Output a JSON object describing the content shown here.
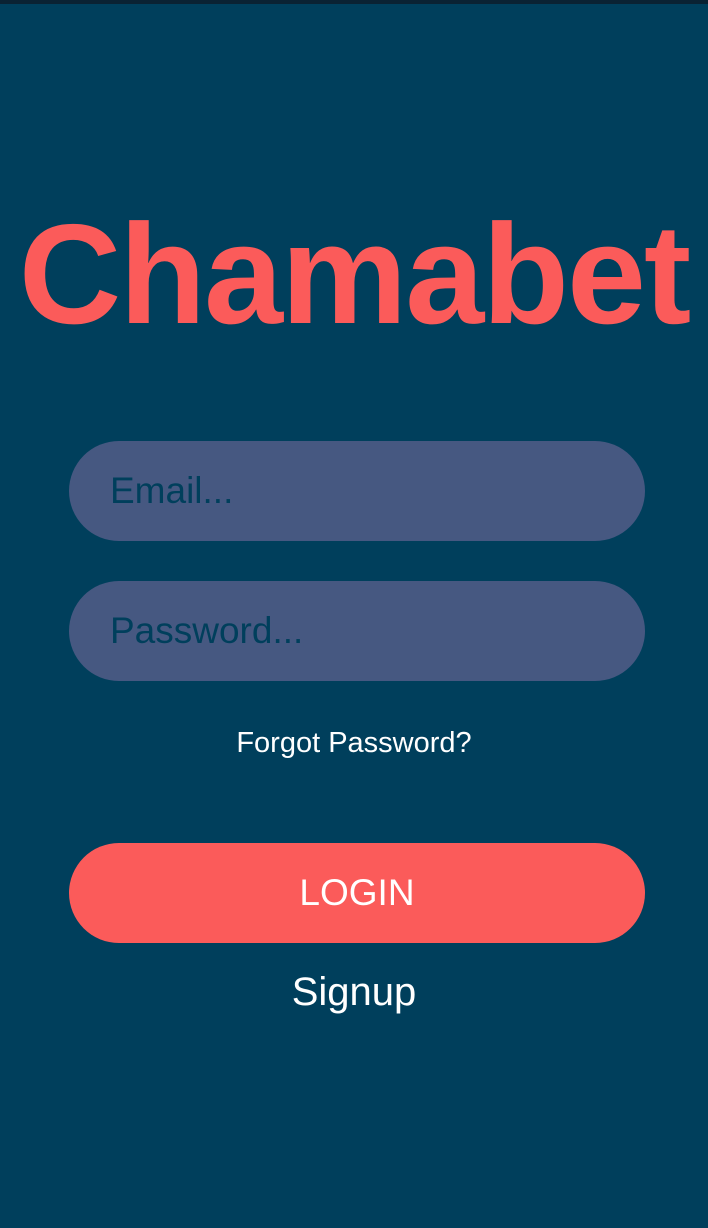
{
  "app": {
    "title": "Chamabet"
  },
  "form": {
    "email_placeholder": "Email...",
    "password_placeholder": "Password...",
    "forgot_password_label": "Forgot Password?",
    "login_label": "LOGIN",
    "signup_label": "Signup"
  },
  "colors": {
    "background": "#003f5c",
    "accent": "#fb5b5a",
    "input_background": "#465881",
    "text": "#ffffff"
  }
}
